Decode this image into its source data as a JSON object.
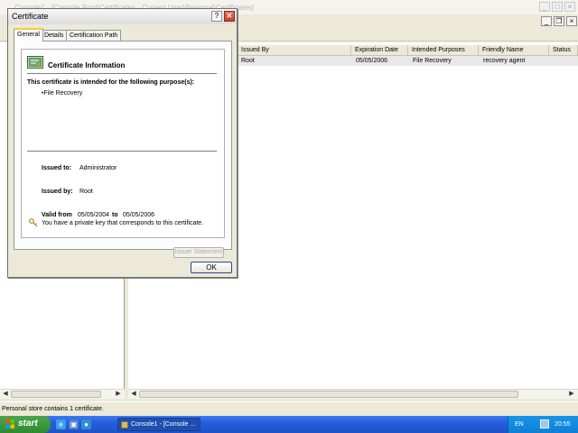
{
  "console": {
    "title": "Console1 - [Console Root\\Certificates - Current User\\Personal\\Certificates]",
    "columns": [
      "Issued By",
      "Expiration Date",
      "Intended Purposes",
      "Friendly Name",
      "Status"
    ],
    "row": {
      "issued_by": "Root",
      "expiration": "05/05/2006",
      "purposes": "File Recovery",
      "friendly_name": "recovery agent"
    },
    "status_bar": "Personal store contains 1 certificate."
  },
  "dialog": {
    "title": "Certificate",
    "help_label": "?",
    "close_label": "✕",
    "tabs": [
      {
        "label": "General"
      },
      {
        "label": "Details"
      },
      {
        "label": "Certification Path"
      }
    ],
    "heading": "Certificate Information",
    "purpose_heading": "This certificate is intended for the following purpose(s):",
    "purpose_item": "•File Recovery",
    "issued_to_label": "Issued to:",
    "issued_to": "Administrator",
    "issued_by_label": "Issued by:",
    "issued_by": "Root",
    "valid_from_label": "Valid from",
    "valid_from": "05/05/2004",
    "to_label": "to",
    "valid_to": "05/05/2006",
    "key_note": "You have a private key that corresponds to this certificate.",
    "issuer_statement": "Issuer Statement",
    "ok": "OK"
  },
  "taskbar": {
    "start": "start",
    "task": "Console1 - [Console ...",
    "language": "EN",
    "clock": "20:55"
  },
  "icons": [
    "certificate-icon",
    "key-icon",
    "help-icon",
    "close-icon",
    "minimize-icon",
    "maximize-icon",
    "scroll-left-icon",
    "scroll-right-icon",
    "windows-logo-icon"
  ]
}
